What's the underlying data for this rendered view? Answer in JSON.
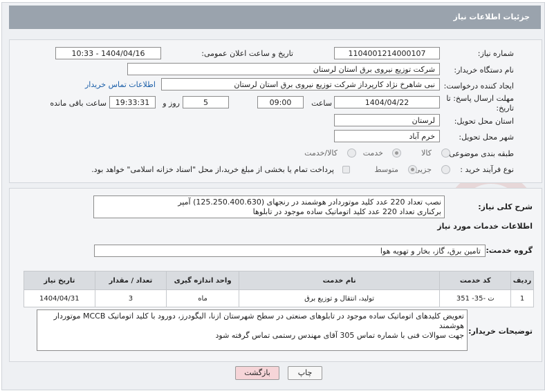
{
  "header": {
    "title": "جزئیات اطلاعات نیاز"
  },
  "form": {
    "need_number_label": "شماره نیاز:",
    "need_number": "1104001214000107",
    "announce_label": "تاریخ و ساعت اعلان عمومی:",
    "announce_value": "1404/04/16 - 10:33",
    "buyer_org_label": "نام دستگاه خریدار:",
    "buyer_org": "شرکت توزیع نیروی برق استان لرستان",
    "creator_label": "ایجاد کننده درخواست:",
    "creator": "نبی شاهرخ نژاد کارپرداز شرکت توزیع نیروی برق استان لرستان",
    "buyer_contact_link": "اطلاعات تماس خریدار",
    "deadline_label_1": "مهلت ارسال پاسخ: تا",
    "deadline_label_2": "تاریخ:",
    "deadline_date": "1404/04/22",
    "time_label": "ساعت",
    "deadline_time": "09:00",
    "days_value": "5",
    "days_label": "روز و",
    "remaining_time": "19:33:31",
    "remaining_label": "ساعت باقی مانده",
    "province_label": "استان محل تحویل:",
    "province": "لرستان",
    "city_label": "شهر محل تحویل:",
    "city": "خرم آباد",
    "category_label": "طبقه بندی موضوعی:",
    "category_options": [
      "کالا",
      "خدمت",
      "کالا/خدمت"
    ],
    "category_selected": 1,
    "process_label": "نوع فرآیند خرید :",
    "process_options": [
      "جزیی",
      "متوسط"
    ],
    "process_selected": 1,
    "payment_note": "پرداخت تمام یا بخشی از مبلغ خرید،از محل \"اسناد خزانه اسلامی\" خواهد بود."
  },
  "summary": {
    "label": "شرح کلی نیاز:",
    "line1": "نصب تعداد 220 عدد کلید موتوردادر هوشمند در رنجهای (125.250.400.630) آمپر",
    "line2": "برکناری تعداد 220 عدد کلید اتوماتیک ساده موجود در تابلوها"
  },
  "services": {
    "section_title": "اطلاعات خدمات مورد نیاز",
    "group_label": "گروه خدمت:",
    "group_value": "تامین برق، گاز، بخار و تهویه هوا",
    "columns": [
      "ردیف",
      "کد خدمت",
      "نام خدمت",
      "واحد اندازه گیری",
      "تعداد / مقدار",
      "تاریخ نیاز"
    ],
    "rows": [
      [
        "1",
        "ت -35- 351",
        "تولید، انتقال و توزیع برق",
        "ماه",
        "3",
        "1404/04/31"
      ]
    ]
  },
  "notes": {
    "label": "توضیحات خریدار:",
    "line1": "تعویض کلیدهای اتوماتیک ساده موجود در تابلوهای صنعتی در سطح شهرستان   ازنا، الیگودرز، دورود با کلید اتوماتیک MCCB موتوردار هوشمند",
    "line2": "جهت سوالات فنی با شماره تماس 305 آقای مهندس رستمی تماس گرفته شود"
  },
  "buttons": {
    "print": "چاپ",
    "back": "بازگشت"
  },
  "colors": {
    "header_bg": "#9aa3ad",
    "link": "#1a5ea8",
    "back_btn_bg": "#f6d5d8"
  }
}
